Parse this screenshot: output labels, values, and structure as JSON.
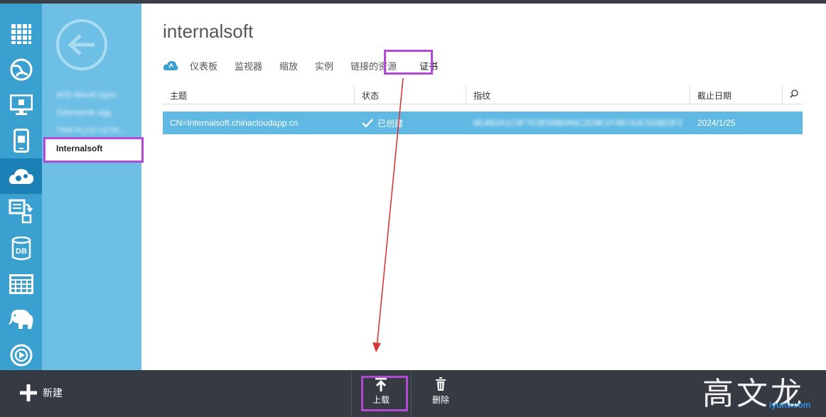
{
  "app": {
    "title": "internalsoft"
  },
  "rail": {
    "items": [
      {
        "icon": "all-items-grid-icon"
      },
      {
        "icon": "web-sites-globe-icon"
      },
      {
        "icon": "virtual-machines-monitor-icon"
      },
      {
        "icon": "mobile-services-icon"
      },
      {
        "icon": "cloud-services-gear-icon",
        "active": true
      },
      {
        "icon": "batch-job-icon"
      },
      {
        "icon": "sql-database-icon",
        "text": "DB"
      },
      {
        "icon": "storage-table-icon"
      },
      {
        "icon": "hdinsight-elephant-icon"
      },
      {
        "icon": "media-services-play-icon"
      }
    ]
  },
  "subnav": {
    "items": [
      {
        "label": "AFD Blendi Ugon",
        "blurred": true
      },
      {
        "label": "Syfenderds agg",
        "blurred": true
      },
      {
        "label": "TRM PLUS CETR...",
        "blurred": true
      },
      {
        "label": "Internalsoft",
        "selected": true
      }
    ]
  },
  "tabs": [
    {
      "label": "仪表板"
    },
    {
      "label": "监视器"
    },
    {
      "label": "缩放"
    },
    {
      "label": "实例"
    },
    {
      "label": "链接的资源"
    },
    {
      "label": "证书",
      "active": true
    }
  ],
  "table": {
    "headers": [
      "主题",
      "状态",
      "指纹",
      "截止日期"
    ],
    "rows": [
      {
        "subject": "CN=Internalsoft.chinacloudapp.cn",
        "status": "已创建",
        "thumbprint": "6E4B2A1C9F7D3E58B0A6C2D9E1F4B7A3C5D8E0F2",
        "expiry": "2024/1/25"
      }
    ]
  },
  "commands": {
    "new_label": "新建",
    "upload_label": "上载",
    "delete_label": "删除"
  },
  "watermark": {
    "text": "高文龙",
    "site": "iyunv.com"
  },
  "colors": {
    "rail": "#3aa0d0",
    "rail_active": "#1a80b6",
    "subnav": "#6ebfe6",
    "row_selected": "#5fb9e2",
    "command_bar": "#353a43",
    "highlight": "#b34ad6",
    "arrow": "#d43a3a"
  }
}
